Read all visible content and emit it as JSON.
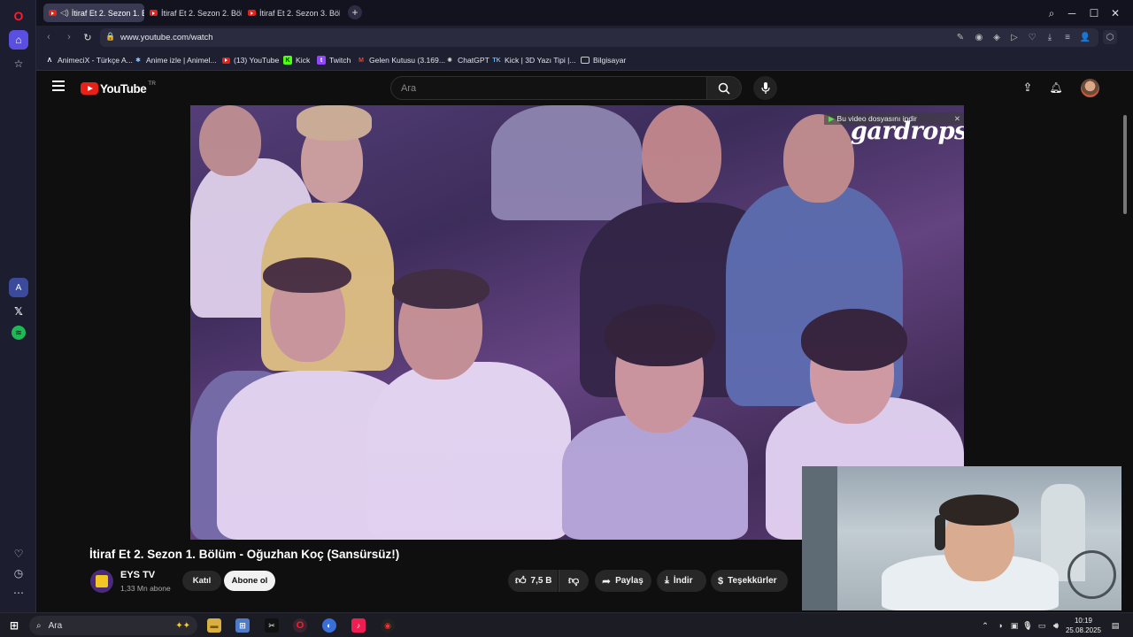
{
  "browser": {
    "tabs": [
      {
        "label": "İtiraf Et 2. Sezon 1. Bö",
        "active": true,
        "muted_icon": "speaker-icon"
      },
      {
        "label": "İtiraf Et 2. Sezon 2. Bölüm",
        "active": false
      },
      {
        "label": "İtiraf Et 2. Sezon 3. Bölüm",
        "active": false
      }
    ],
    "url": "www.youtube.com/watch",
    "bookmarks": [
      {
        "label": "AnimeciX - Türkçe A..."
      },
      {
        "label": "Anime izle | Animel..."
      },
      {
        "label": "(13) YouTube"
      },
      {
        "label": "Kick"
      },
      {
        "label": "Twitch"
      },
      {
        "label": "Gelen Kutusu (3.169..."
      },
      {
        "label": "ChatGPT"
      },
      {
        "label": "Kick | 3D Yazı Tipi |..."
      },
      {
        "label": "Bilgisayar"
      }
    ]
  },
  "youtube": {
    "logo_text": "YouTube",
    "region": "TR",
    "search_placeholder": "Ara",
    "video": {
      "overlay_download": "Bu video dosyasını indir",
      "watermark": "gardrops"
    },
    "title": "İtiraf Et 2. Sezon 1. Bölüm - Oğuzhan Koç (Sansürsüz!)",
    "channel": {
      "name": "EYS TV",
      "subscribers": "1,33 Mn abone"
    },
    "join_label": "Katıl",
    "subscribe_label": "Abone ol",
    "likes": "7,5 B",
    "share_label": "Paylaş",
    "download_label": "İndir",
    "thanks_label": "Teşekkürler"
  },
  "taskbar": {
    "search_placeholder": "Ara",
    "time": "10:19",
    "date": "25.08.2025"
  },
  "colors": {
    "youtube_red": "#e62117",
    "opera_red": "#ff1b2d",
    "accent_blue": "#3ea6ff"
  }
}
